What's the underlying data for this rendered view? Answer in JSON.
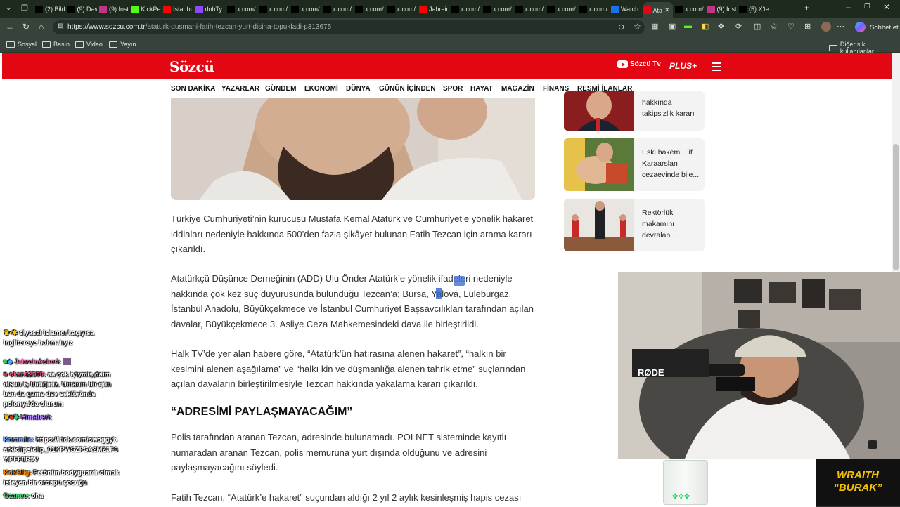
{
  "browser": {
    "tabs": [
      {
        "label": "(2) Bildi",
        "icon": "x-icon",
        "color": "#000000"
      },
      {
        "label": "(9) Dav",
        "icon": "x-icon",
        "color": "#000000"
      },
      {
        "label": "(9) Inst",
        "icon": "instagram-icon",
        "color": "#c13584"
      },
      {
        "label": "KickPe",
        "icon": "kick-icon",
        "color": "#53fc18"
      },
      {
        "label": "İstanbı",
        "icon": "youtube-icon",
        "color": "#ff0000"
      },
      {
        "label": "dohTy",
        "icon": "twitch-icon",
        "color": "#9146ff"
      },
      {
        "label": "x.com/",
        "icon": "x-icon",
        "color": "#000000"
      },
      {
        "label": "x.com/",
        "icon": "x-icon",
        "color": "#000000"
      },
      {
        "label": "x.com/",
        "icon": "x-icon",
        "color": "#000000"
      },
      {
        "label": "x.com/",
        "icon": "x-icon",
        "color": "#000000"
      },
      {
        "label": "x.com/",
        "icon": "x-icon",
        "color": "#000000"
      },
      {
        "label": "x.com/",
        "icon": "x-icon",
        "color": "#000000"
      },
      {
        "label": "Jahrein",
        "icon": "youtube-icon",
        "color": "#ff0000"
      },
      {
        "label": "x.com/",
        "icon": "x-icon",
        "color": "#000000"
      },
      {
        "label": "x.com/",
        "icon": "x-icon",
        "color": "#000000"
      },
      {
        "label": "x.com/",
        "icon": "x-icon",
        "color": "#000000"
      },
      {
        "label": "x.com/",
        "icon": "x-icon",
        "color": "#000000"
      },
      {
        "label": "x.com/",
        "icon": "x-icon",
        "color": "#000000"
      },
      {
        "label": "Watch",
        "icon": "watch-icon",
        "color": "#1a73e8"
      },
      {
        "label": "Ata",
        "icon": "sozcu-icon",
        "color": "#e30613",
        "active": true
      },
      {
        "label": "x.com/",
        "icon": "x-icon",
        "color": "#000000"
      },
      {
        "label": "(9) Inst",
        "icon": "instagram-icon",
        "color": "#c13584"
      },
      {
        "label": "(5) X'te",
        "icon": "x-icon",
        "color": "#000000"
      }
    ],
    "url_domain": "https://www.sozcu.com.tr",
    "url_path": "/ataturk-dusmani-fatih-tezcan-yurt-disina-topukladi-p313675",
    "chat_button": "Sohbet et",
    "bookmarks": [
      "Sosyal",
      "Basın",
      "Video",
      "Yayın"
    ],
    "other_bookmarks": "Diğer sık kullanılanlar"
  },
  "site": {
    "logo": "Sözcü",
    "tv_label": "Sözcü Tv",
    "plus_label": "PLUS+",
    "brand_color": "#e30613",
    "nav": [
      "SON DAKİKA",
      "YAZARLAR",
      "GÜNDEM",
      "EKONOMİ",
      "DÜNYA",
      "GÜNÜN İÇİNDEN",
      "SPOR",
      "HAYAT",
      "MAGAZİN",
      "FİNANS",
      "RESMİ İLANLAR"
    ]
  },
  "article": {
    "p1": "Türkiye Cumhuriyeti’nin kurucusu Mustafa Kemal Atatürk ve Cumhuriyet’e yönelik hakaret iddiaları nedeniyle hakkında 500’den fazla şikâyet bulunan Fatih Tezcan için arama kararı çıkarıldı.",
    "p2": "Atatürkçü Düşünce Derneğinin (ADD) Ulu Önder Atatürk’e yönelik ifadeleri nedeniyle hakkında çok kez suç duyurusunda bulunduğu Tezcan’a; Bursa, Yalova, Lüleburgaz, İstanbul Anadolu, Büyükçekmece ve İstanbul Cumhuriyet Başsavcılıkları tarafından açılan davalar, Büyükçekmece 3. Asliye Ceza Mahkemesindeki dava ile birleştirildi.",
    "p3": "Halk TV’de yer alan habere göre, “Atatürk’ün hatırasına alenen hakaret”, “halkın bir kesimini alenen aşağılama” ve “halkı kin ve düşmanlığa alenen tahrik etme” suçlarından açılan davaların birleştirilmesiyle Tezcan hakkında yakalama kararı çıkarıldı.",
    "subheading": "“ADRESİMİ PAYLAŞMAYACAĞIM”",
    "p4": "Polis tarafından aranan Tezcan, adresinde bulunamadı. POLNET sisteminde kayıtlı numaradan aranan Tezcan, polis memuruna yurt dışında olduğunu ve adresini paylaşmayacağını söyledi.",
    "p5": "Fatih Tezcan, “Atatürk’e hakaret” suçundan aldığı 2 yıl 2 aylık kesinleşmiş hapis cezası"
  },
  "sidebar": [
    {
      "title": "hakkında takipsizlik kararı"
    },
    {
      "title": "Eski hakem Elif Karaarslan cezaevinde bile..."
    },
    {
      "title": "Rektörlük makamını devralan..."
    }
  ],
  "chat": [
    {
      "user": "",
      "text": "siyasal islamcı kaçıyısa ingiltereye bakmalıyız",
      "color": "#ffffff"
    },
    {
      "user": "JahreinAskeri:",
      "text": "",
      "color": "#ff69b4"
    },
    {
      "user": "okan12300:",
      "text": "aa çok iyiymiş,daim olsun iş birliğiniz. Umarım bir gün ben de game dev sektöründe polonya'da olurum",
      "color": "#ff4a7a"
    },
    {
      "user": "Himaberi:",
      "text": "",
      "color": "#b88cff"
    },
    {
      "user": "Karamilc:",
      "text": "https://kick.com/swaggybark/clips/clip_01KPWSZPSA2MZ3F6Y.PFF8R9V",
      "color": "#6fa8ff"
    },
    {
      "user": "KokOlig:",
      "text": "Fetönün bodyguardı olmak isteyen bir orospu çocuğu",
      "color": "#ff8c00"
    },
    {
      "user": "Ozanee:",
      "text": "oha",
      "color": "#4ade80"
    }
  ],
  "stream": {
    "brand_line1": "WRAITH",
    "brand_line2": "“BURAK”",
    "mic_brand": "RØDE",
    "brand_color": "#f5c400"
  }
}
